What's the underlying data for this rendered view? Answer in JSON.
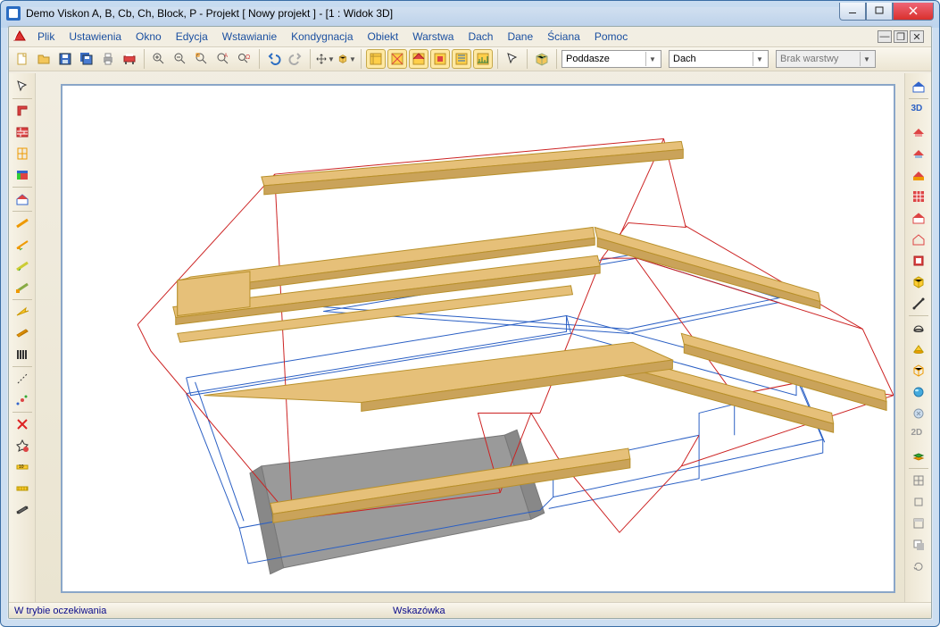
{
  "window": {
    "title": "Demo Viskon A, B, Cb, Ch, Block, P - Projekt [ Nowy projekt ]  - [1 : Widok 3D]"
  },
  "menu": {
    "items": [
      "Plik",
      "Ustawienia",
      "Okno",
      "Edycja",
      "Wstawianie",
      "Kondygnacja",
      "Obiekt",
      "Warstwa",
      "Dach",
      "Dane",
      "Ściana",
      "Pomoc"
    ]
  },
  "toolbar": {
    "combos": {
      "floor": {
        "value": "Poddasze"
      },
      "element": {
        "value": "Dach"
      },
      "layer": {
        "value": "Brak warstwy"
      }
    }
  },
  "status": {
    "left": "W trybie oczekiwania",
    "mid": "Wskazówka"
  },
  "left_tools": [
    "cursor",
    "corner",
    "wall",
    "grid",
    "colorwall",
    "house",
    "rafter1",
    "rafter2",
    "rafter3",
    "rafter4",
    "arrow-y",
    "board",
    "hatch",
    "line",
    "point",
    "del-x",
    "mark",
    "ruler1",
    "ruler2",
    "beam"
  ],
  "right_tools": [
    "home",
    "3d",
    "roof-r",
    "roof-b",
    "roof-o",
    "grid3",
    "house-r",
    "house-o",
    "panel",
    "cube-y",
    "wire",
    "dome",
    "prism",
    "cube-o",
    "sphere",
    "light",
    "2d",
    "layers",
    "sep",
    "grid-s",
    "square",
    "th",
    "shadow",
    "rot"
  ]
}
